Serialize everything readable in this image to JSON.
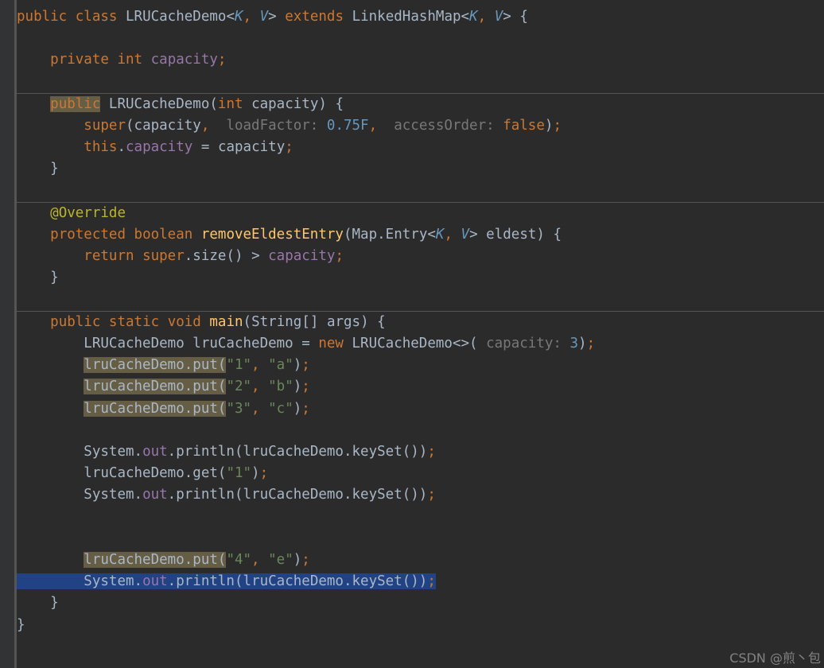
{
  "code": {
    "kw_public": "public",
    "kw_class": "class",
    "cls_LRUCacheDemo": "LRUCacheDemo",
    "lt": "<",
    "gt": ">",
    "K": "K",
    "comma_sp": ", ",
    "V": "V",
    "kw_extends": "extends",
    "cls_LinkedHashMap": "LinkedHashMap",
    "ob": "{",
    "cb": "}",
    "kw_private": "private",
    "kw_int": "int",
    "f_capacity": "capacity",
    "semi": ";",
    "m_LRUCacheDemo": "LRUCacheDemo",
    "p_capacity": "capacity",
    "kw_super": "super",
    "hint_loadFactor": "loadFactor:",
    "v_075F": "0.75F",
    "hint_accessOrder": "accessOrder:",
    "kw_false": "false",
    "kw_this": "this",
    "eq": "=",
    "ann_Override": "@Override",
    "kw_protected": "protected",
    "kw_boolean": "boolean",
    "m_removeEldestEntry": "removeEldestEntry",
    "cls_Map": "Map",
    "dot": ".",
    "cls_Entry": "Entry",
    "p_eldest": "eldest",
    "kw_return": "return",
    "m_size": "size",
    "gt_op": " > ",
    "kw_static": "static",
    "kw_void": "void",
    "m_main": "main",
    "cls_String": "String",
    "brackets": "[]",
    "p_args": "args",
    "v_lruCacheDemo": "lruCacheDemo",
    "kw_new": "new",
    "diamond": "<>",
    "hint_capacity": "capacity:",
    "v_3": "3",
    "m_put": "put",
    "s_1": "\"1\"",
    "s_a": "\"a\"",
    "s_2": "\"2\"",
    "s_b": "\"b\"",
    "s_3": "\"3\"",
    "s_c": "\"c\"",
    "cls_System": "System",
    "f_out": "out",
    "m_println": "println",
    "m_keySet": "keySet",
    "m_get": "get",
    "s_4": "\"4\"",
    "s_e": "\"e\""
  },
  "watermark": "CSDN @煎丶包"
}
